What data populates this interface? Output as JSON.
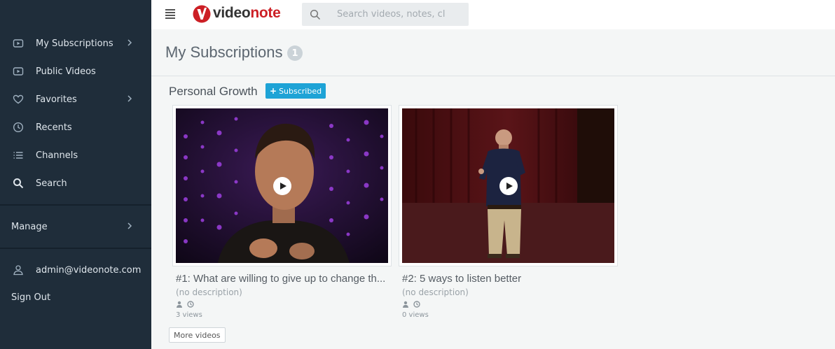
{
  "app": {
    "name_prefix": "video",
    "name_suffix": "note"
  },
  "search": {
    "placeholder": "Search videos, notes, cl"
  },
  "sidebar": {
    "items": [
      {
        "label": "My Subscriptions",
        "icon": "video-icon",
        "has_chevron": true
      },
      {
        "label": "Public Videos",
        "icon": "video-icon",
        "has_chevron": false
      },
      {
        "label": "Favorites",
        "icon": "heart-icon",
        "has_chevron": true
      },
      {
        "label": "Recents",
        "icon": "clock-icon",
        "has_chevron": false
      },
      {
        "label": "Channels",
        "icon": "list-icon",
        "has_chevron": false
      },
      {
        "label": "Search",
        "icon": "search-icon",
        "has_chevron": false
      }
    ],
    "manage_label": "Manage",
    "user_email": "admin@videonote.com",
    "signout_label": "Sign Out"
  },
  "page": {
    "title": "My Subscriptions",
    "count": "1"
  },
  "channel": {
    "name": "Personal Growth",
    "subscribe_label": "Subscribed",
    "more_label": "More videos"
  },
  "videos": [
    {
      "title": "#1: What are willing to give up to change th...",
      "description": "(no description)",
      "views": "3 views"
    },
    {
      "title": "#2: 5 ways to listen better",
      "description": "(no description)",
      "views": "0 views"
    }
  ],
  "colors": {
    "sidebar_bg": "#1f2d3a",
    "brand_red": "#cc1f25",
    "accent_blue": "#1ea3d6"
  }
}
